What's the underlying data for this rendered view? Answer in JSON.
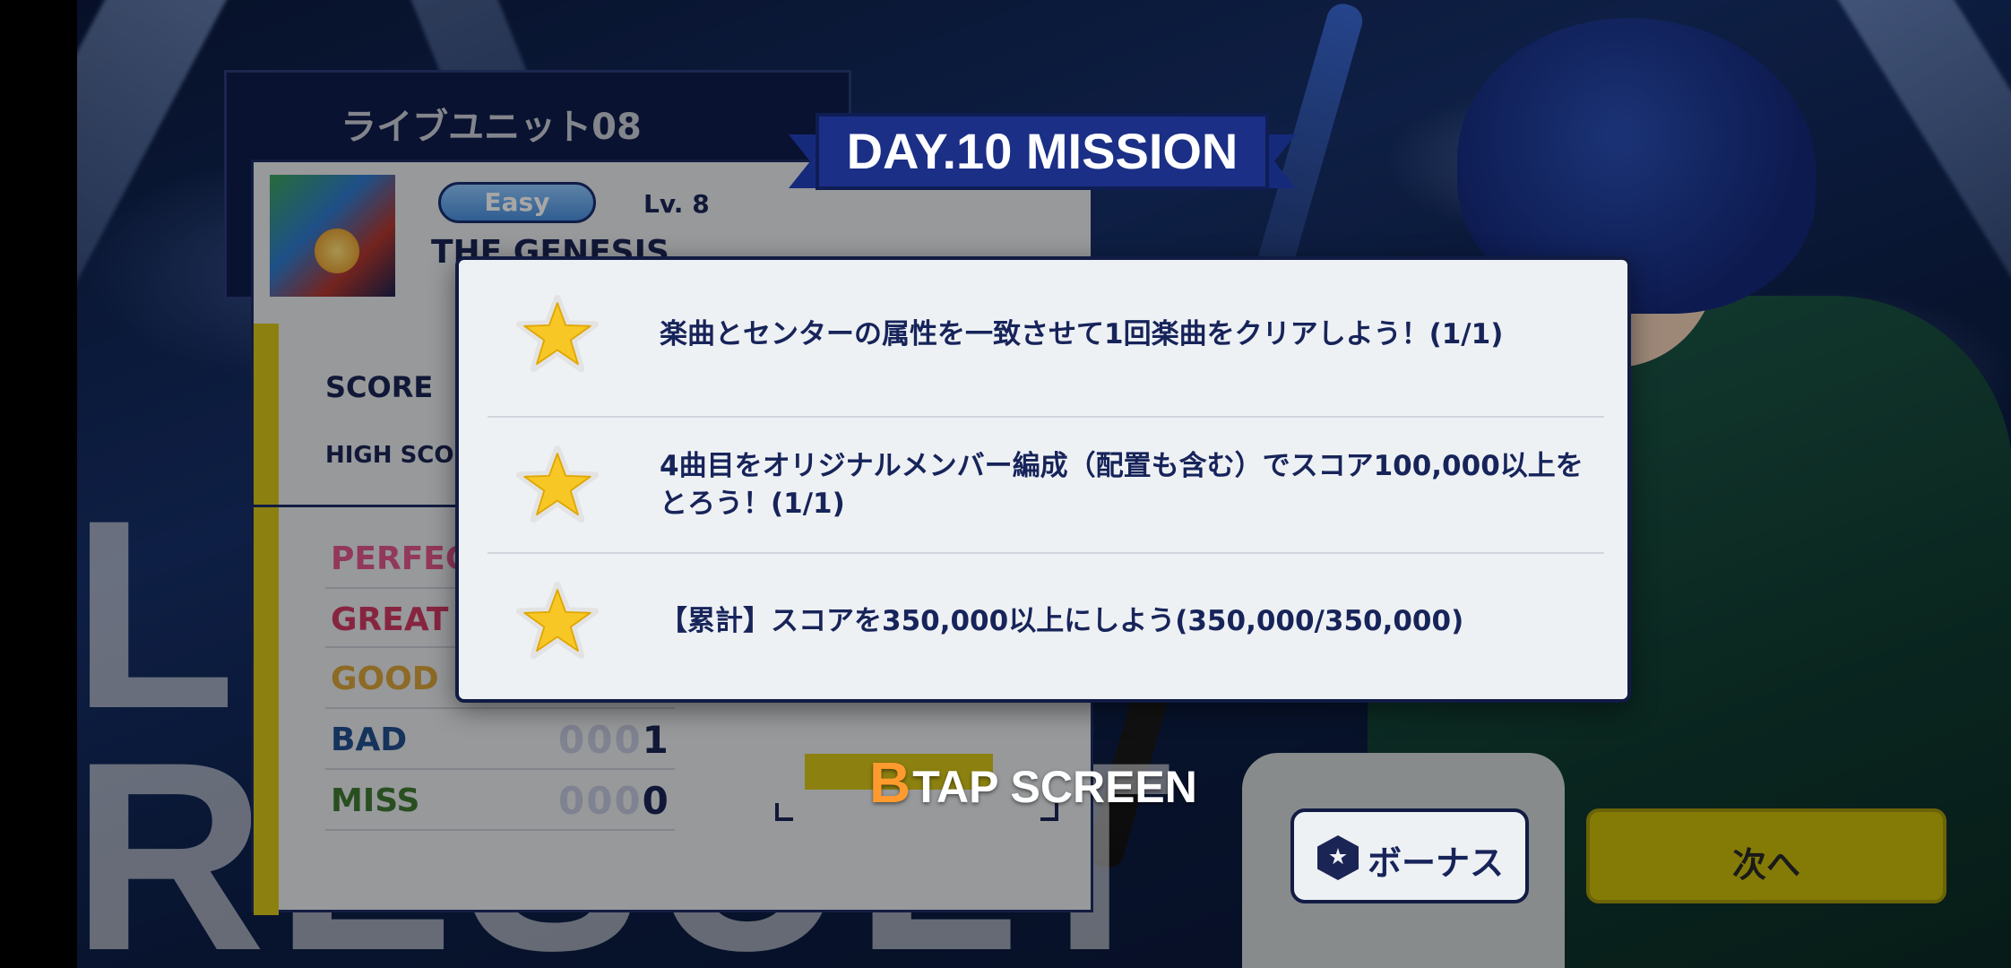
{
  "result": {
    "unit_title": "ライブユニット08",
    "difficulty": "Easy",
    "level": "Lv. 8",
    "song_title": "THE GENESIS",
    "score_label": "SCORE",
    "high_score_label": "HIGH SCORE",
    "judgements": [
      {
        "label": "PERFECT",
        "color": "#e0568b",
        "value_dim": "",
        "value": ""
      },
      {
        "label": "GREAT",
        "color": "#d03a63",
        "value_dim": "",
        "value": ""
      },
      {
        "label": "GOOD",
        "color": "#d9a33a",
        "value_dim": "",
        "value": ""
      },
      {
        "label": "BAD",
        "color": "#214f8e",
        "value_dim": "000",
        "value": "1"
      },
      {
        "label": "MISS",
        "color": "#3f7a34",
        "value_dim": "000",
        "value": "0"
      }
    ],
    "rank_letter": "B",
    "tap_text": "TAP SCREEN",
    "background_text": "LIVE RESULT"
  },
  "mission": {
    "banner": "DAY.10 MISSION",
    "items": [
      {
        "text": "楽曲とセンターの属性を一致させて1回楽曲をクリアしよう！(1/1)"
      },
      {
        "text": "4曲目をオリジナルメンバー編成（配置も含む）でスコア100,000以上をとろう！(1/1)"
      },
      {
        "text": "【累計】スコアを350,000以上にしよう(350,000/350,000)"
      }
    ]
  },
  "buttons": {
    "bonus": "ボーナス",
    "next": "次へ"
  },
  "colors": {
    "accent_yellow": "#d8c61a",
    "navy": "#1b2555",
    "star": "#f7c726"
  }
}
